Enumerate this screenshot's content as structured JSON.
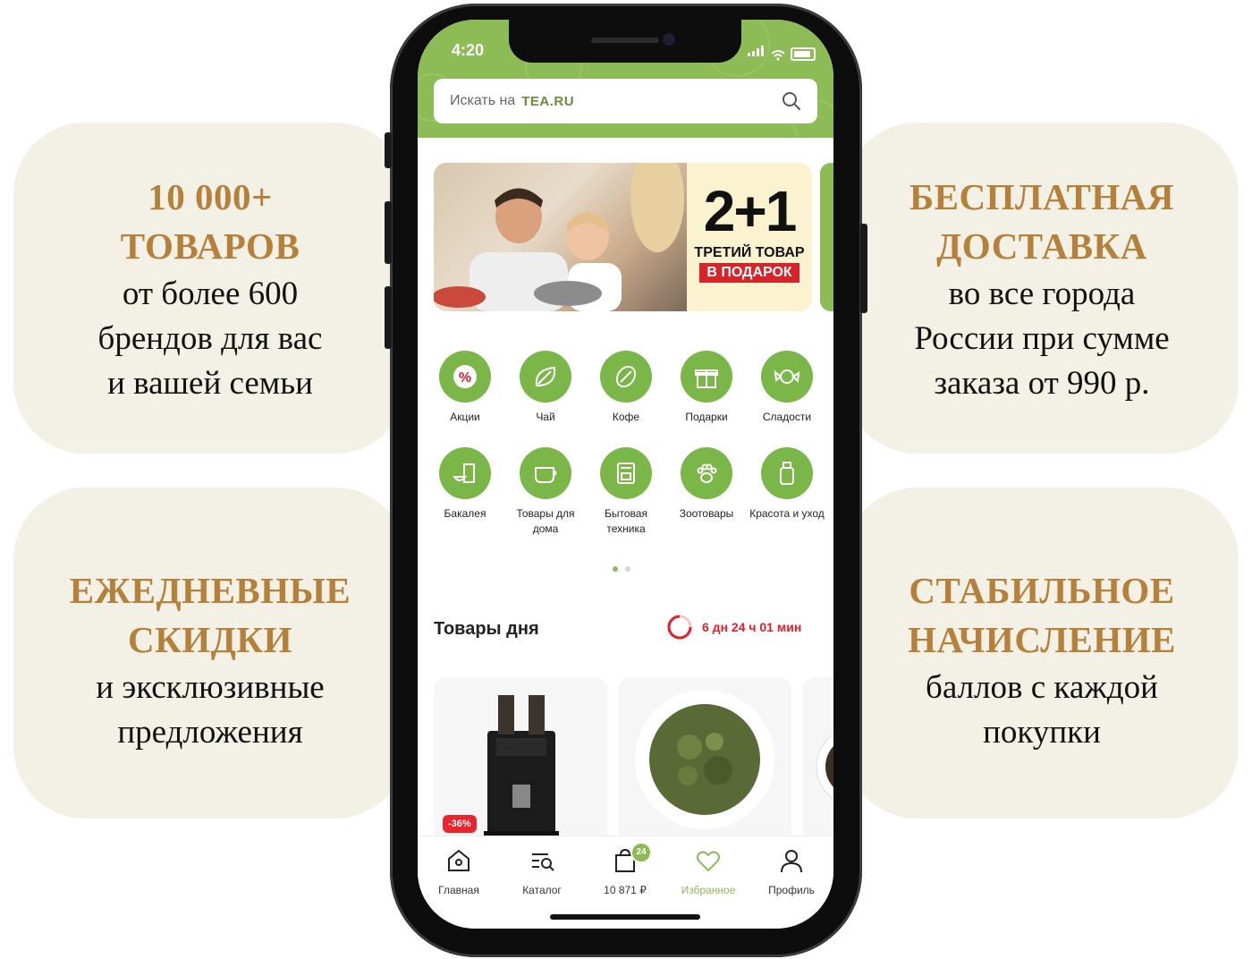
{
  "features": {
    "top_left": {
      "title": [
        "10 000+",
        "ТОВАРОВ"
      ],
      "subtitle": [
        "от более 600",
        "брендов для вас",
        "и вашей семьи"
      ]
    },
    "top_right": {
      "title": [
        "БЕСПЛАТНАЯ",
        "ДОСТАВКА"
      ],
      "subtitle": [
        "во все города",
        "России при сумме",
        "заказа от 990 р."
      ]
    },
    "bottom_left": {
      "title": [
        "ЕЖЕДНЕВНЫЕ",
        "СКИДКИ"
      ],
      "subtitle": [
        "и эксклюзивные",
        "предложения"
      ]
    },
    "bottom_right": {
      "title": [
        "СТАБИЛЬНОЕ",
        "НАЧИСЛЕНИЕ"
      ],
      "subtitle": [
        "баллов с каждой",
        "покупки"
      ]
    }
  },
  "status_bar": {
    "time": "4:20"
  },
  "search": {
    "placeholder": "Искать на",
    "brand": "TEA.RU"
  },
  "banner": {
    "big": "2+1",
    "line1": "ТРЕТИЙ ТОВАР",
    "line2": "В ПОДАРОК"
  },
  "categories": [
    {
      "label": "Акции",
      "icon": "percent-badge-icon"
    },
    {
      "label": "Чай",
      "icon": "tea-leaf-icon"
    },
    {
      "label": "Кофе",
      "icon": "coffee-bean-icon"
    },
    {
      "label": "Подарки",
      "icon": "gift-icon"
    },
    {
      "label": "Сладости",
      "icon": "candy-icon"
    },
    {
      "label": "Бакалея",
      "icon": "grocery-icon"
    },
    {
      "label": "Товары для дома",
      "icon": "home-goods-icon"
    },
    {
      "label": "Бытовая техника",
      "icon": "appliance-icon"
    },
    {
      "label": "Зоотовары",
      "icon": "paw-icon"
    },
    {
      "label": "Красота и уход",
      "icon": "beauty-icon"
    }
  ],
  "deals": {
    "title": "Товары дня",
    "timer": "6 дн 24 ч 01 мин",
    "discount_badge": "-36%"
  },
  "tabbar": {
    "home": "Главная",
    "catalog": "Каталог",
    "cart": "10 871 ₽",
    "cart_count": "24",
    "favorites": "Избранное",
    "profile": "Профиль"
  },
  "colors": {
    "accent": "#8dbb55",
    "gold": "#b5803a",
    "card_bg": "#f3f0e6",
    "sale_red": "#e0202a"
  }
}
